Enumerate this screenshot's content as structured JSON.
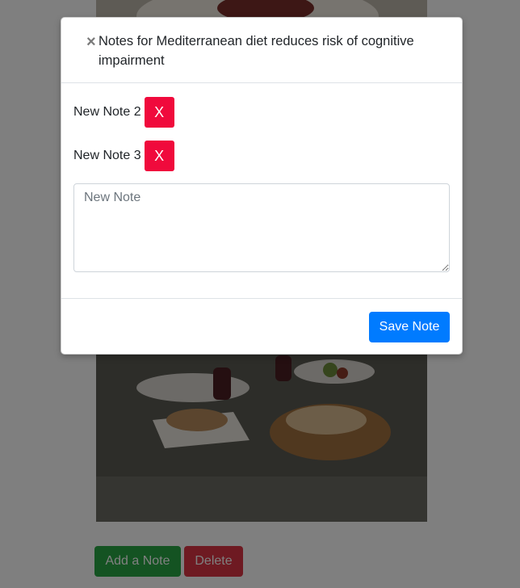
{
  "modal": {
    "close_glyph": "×",
    "title": "Notes for Mediterranean diet reduces risk of cognitive impairment",
    "notes": [
      {
        "text": "New Note 2",
        "delete_label": "X"
      },
      {
        "text": "New Note 3",
        "delete_label": "X"
      }
    ],
    "input": {
      "value": "",
      "placeholder": "New Note"
    },
    "save_label": "Save Note"
  },
  "page": {
    "add_note_label": "Add a Note",
    "delete_label": "Delete"
  },
  "colors": {
    "primary": "#007bff",
    "danger_note": "#f00a3c",
    "success": "#28a745",
    "danger": "#dc3545"
  }
}
